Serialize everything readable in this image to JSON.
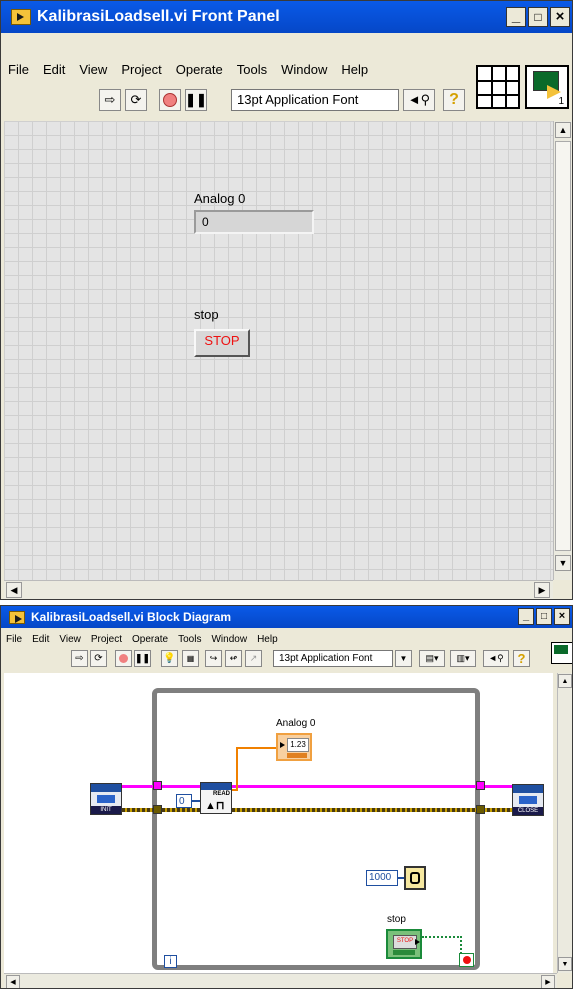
{
  "front_panel": {
    "title": "KalibrasiLoadsell.vi Front Panel",
    "window_buttons": [
      "_",
      "□",
      "×"
    ],
    "menu": [
      "File",
      "Edit",
      "View",
      "Project",
      "Operate",
      "Tools",
      "Window",
      "Help"
    ],
    "font_selector": "13pt Application Font",
    "controls": {
      "analog_label": "Analog 0",
      "analog_value": "0",
      "stop_label": "stop",
      "stop_button_text": "STOP"
    },
    "connector_pane_number": "1"
  },
  "block_diagram": {
    "title": "KalibrasiLoadsell.vi Block Diagram",
    "window_buttons": [
      "_",
      "□",
      "×"
    ],
    "menu": [
      "File",
      "Edit",
      "View",
      "Project",
      "Operate",
      "Tools",
      "Window",
      "Help"
    ],
    "font_selector": "13pt Application Font",
    "nodes": {
      "analog_label": "Analog 0",
      "indicator_text": "1.23",
      "init_text": "INIT",
      "read_text": "READ",
      "close_text": "CLOSE",
      "pin_constant": "0",
      "wait_constant": "1000",
      "stop_label": "stop",
      "stop_terminal_text": "STOP",
      "iteration_label": "i"
    }
  },
  "colors": {
    "titlebar": "#0a5ae8",
    "grid_bg": "#e4e4e4",
    "stop_text": "#e11111",
    "wire_pink": "#ff00ff",
    "wire_dark": "#4a3a10",
    "wire_yellow": "#c8a000",
    "while_loop": "#7f7f7f"
  }
}
